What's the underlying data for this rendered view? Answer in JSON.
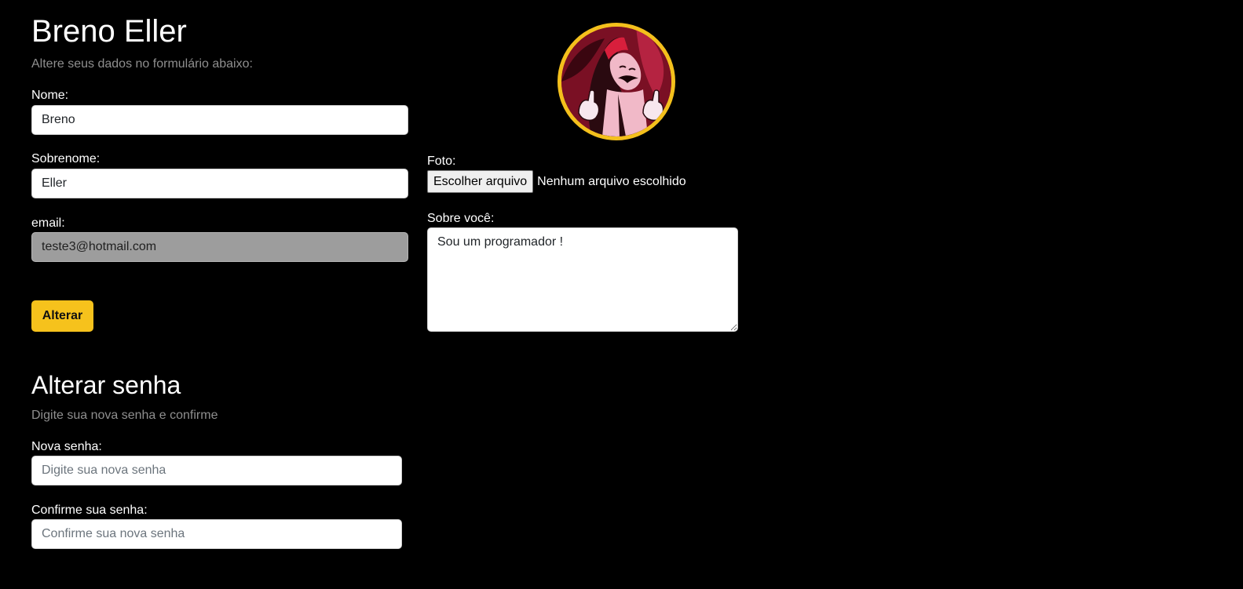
{
  "profile": {
    "title": "Breno Eller",
    "subtitle": "Altere seus dados no formulário abaixo:",
    "nome_label": "Nome:",
    "nome_value": "Breno",
    "sobrenome_label": "Sobrenome:",
    "sobrenome_value": "Eller",
    "email_label": "email:",
    "email_value": "teste3@hotmail.com",
    "submit_label": "Alterar"
  },
  "photo": {
    "label": "Foto:",
    "file_button_label": "Escolher arquivo",
    "file_status": "Nenhum arquivo escolhido",
    "avatar_icon": "profile-avatar-image"
  },
  "about": {
    "label": "Sobre você:",
    "value": "Sou um programador !"
  },
  "password": {
    "title": "Alterar senha",
    "subtitle": "Digite sua nova senha e confirme",
    "new_label": "Nova senha:",
    "new_placeholder": "Digite sua nova senha",
    "confirm_label": "Confirme sua senha:",
    "confirm_placeholder": "Confirme sua nova senha"
  },
  "colors": {
    "background": "#000000",
    "accent": "#f6c21c",
    "muted_text": "#8f8f8f",
    "disabled_input": "#9d9d9d"
  }
}
